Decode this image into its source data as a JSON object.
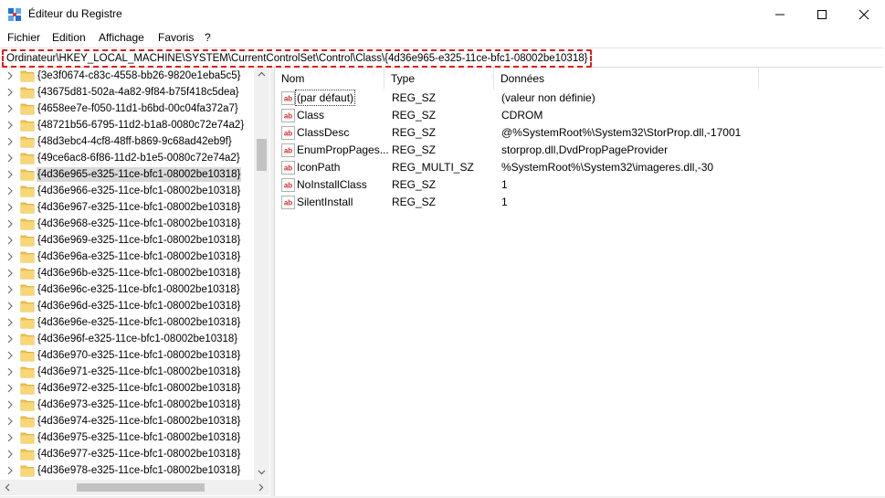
{
  "window": {
    "title": "Éditeur du Registre",
    "controls": [
      "minimize-icon",
      "maximize-icon",
      "close-icon"
    ]
  },
  "menu": [
    "Fichier",
    "Edition",
    "Affichage",
    "Favoris",
    "?"
  ],
  "address": {
    "path": "Ordinateur\\HKEY_LOCAL_MACHINE\\SYSTEM\\CurrentControlSet\\Control\\Class\\{4d36e965-e325-11ce-bfc1-08002be10318}",
    "highlight_color": "#e21b1b"
  },
  "tree": {
    "icon": "folder-icon",
    "expander_icon": "chevron-right-icon",
    "items": [
      {
        "label": "{3e3f0674-c83c-4558-bb26-9820e1eba5c5}"
      },
      {
        "label": "{43675d81-502a-4a82-9f84-b75f418c5dea}"
      },
      {
        "label": "{4658ee7e-f050-11d1-b6bd-00c04fa372a7}"
      },
      {
        "label": "{48721b56-6795-11d2-b1a8-0080c72e74a2}"
      },
      {
        "label": "{48d3ebc4-4cf8-48ff-b869-9c68ad42eb9f}"
      },
      {
        "label": "{49ce6ac8-6f86-11d2-b1e5-0080c72e74a2}"
      },
      {
        "label": "{4d36e965-e325-11ce-bfc1-08002be10318}",
        "selected": true
      },
      {
        "label": "{4d36e966-e325-11ce-bfc1-08002be10318}"
      },
      {
        "label": "{4d36e967-e325-11ce-bfc1-08002be10318}"
      },
      {
        "label": "{4d36e968-e325-11ce-bfc1-08002be10318}"
      },
      {
        "label": "{4d36e969-e325-11ce-bfc1-08002be10318}"
      },
      {
        "label": "{4d36e96a-e325-11ce-bfc1-08002be10318}"
      },
      {
        "label": "{4d36e96b-e325-11ce-bfc1-08002be10318}"
      },
      {
        "label": "{4d36e96c-e325-11ce-bfc1-08002be10318}"
      },
      {
        "label": "{4d36e96d-e325-11ce-bfc1-08002be10318}"
      },
      {
        "label": "{4d36e96e-e325-11ce-bfc1-08002be10318}"
      },
      {
        "label": "{4d36e96f-e325-11ce-bfc1-08002be10318}"
      },
      {
        "label": "{4d36e970-e325-11ce-bfc1-08002be10318}"
      },
      {
        "label": "{4d36e971-e325-11ce-bfc1-08002be10318}"
      },
      {
        "label": "{4d36e972-e325-11ce-bfc1-08002be10318}"
      },
      {
        "label": "{4d36e973-e325-11ce-bfc1-08002be10318}"
      },
      {
        "label": "{4d36e974-e325-11ce-bfc1-08002be10318}"
      },
      {
        "label": "{4d36e975-e325-11ce-bfc1-08002be10318}"
      },
      {
        "label": "{4d36e977-e325-11ce-bfc1-08002be10318}"
      },
      {
        "label": "{4d36e978-e325-11ce-bfc1-08002be10318}"
      }
    ]
  },
  "values_list": {
    "columns": [
      "Nom",
      "Type",
      "Données"
    ],
    "icon": "string-value-icon",
    "rows": [
      {
        "name": "(par défaut)",
        "type": "REG_SZ",
        "data": "(valeur non définie)",
        "selected": true
      },
      {
        "name": "Class",
        "type": "REG_SZ",
        "data": "CDROM"
      },
      {
        "name": "ClassDesc",
        "type": "REG_SZ",
        "data": "@%SystemRoot%\\System32\\StorProp.dll,-17001"
      },
      {
        "name": "EnumPropPages...",
        "type": "REG_SZ",
        "data": "storprop.dll,DvdPropPageProvider"
      },
      {
        "name": "IconPath",
        "type": "REG_MULTI_SZ",
        "data": "%SystemRoot%\\System32\\imageres.dll,-30"
      },
      {
        "name": "NoInstallClass",
        "type": "REG_SZ",
        "data": "1"
      },
      {
        "name": "SilentInstall",
        "type": "REG_SZ",
        "data": "1"
      }
    ]
  }
}
